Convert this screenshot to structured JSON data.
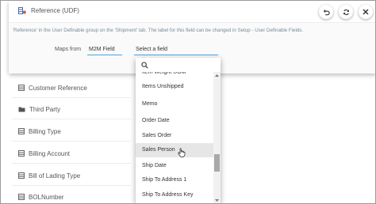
{
  "card": {
    "title": "Reference (UDF)",
    "description": "'Reference' in the User Definable group on the 'Shipment' tab. The label for this field can be changed in Setup - User Definable Fields.",
    "maps_from_label": "Maps from",
    "source_field": "M2M Field",
    "target_select": "Select a field"
  },
  "header_buttons": [
    "undo-icon",
    "refresh-icon",
    "close-icon"
  ],
  "fields": [
    {
      "label": "Customer Reference",
      "icon": "table-icon"
    },
    {
      "label": "Third Party",
      "icon": "folder-icon"
    },
    {
      "label": "Billing Type",
      "icon": "table-icon"
    },
    {
      "label": "Billing Account",
      "icon": "table-icon"
    },
    {
      "label": "Bill of Lading Type",
      "icon": "table-icon"
    },
    {
      "label": "BOLNumber",
      "icon": "table-icon"
    }
  ],
  "dropdown": {
    "search_icon": "search-icon",
    "options": [
      "Item Weight UOM",
      "Items Unshipped",
      "Memo",
      "Order Date",
      "Sales Order",
      "Sales Person",
      "Ship Date",
      "Ship To Address 1",
      "Ship To Address Key"
    ],
    "highlighted": "Sales Person"
  }
}
